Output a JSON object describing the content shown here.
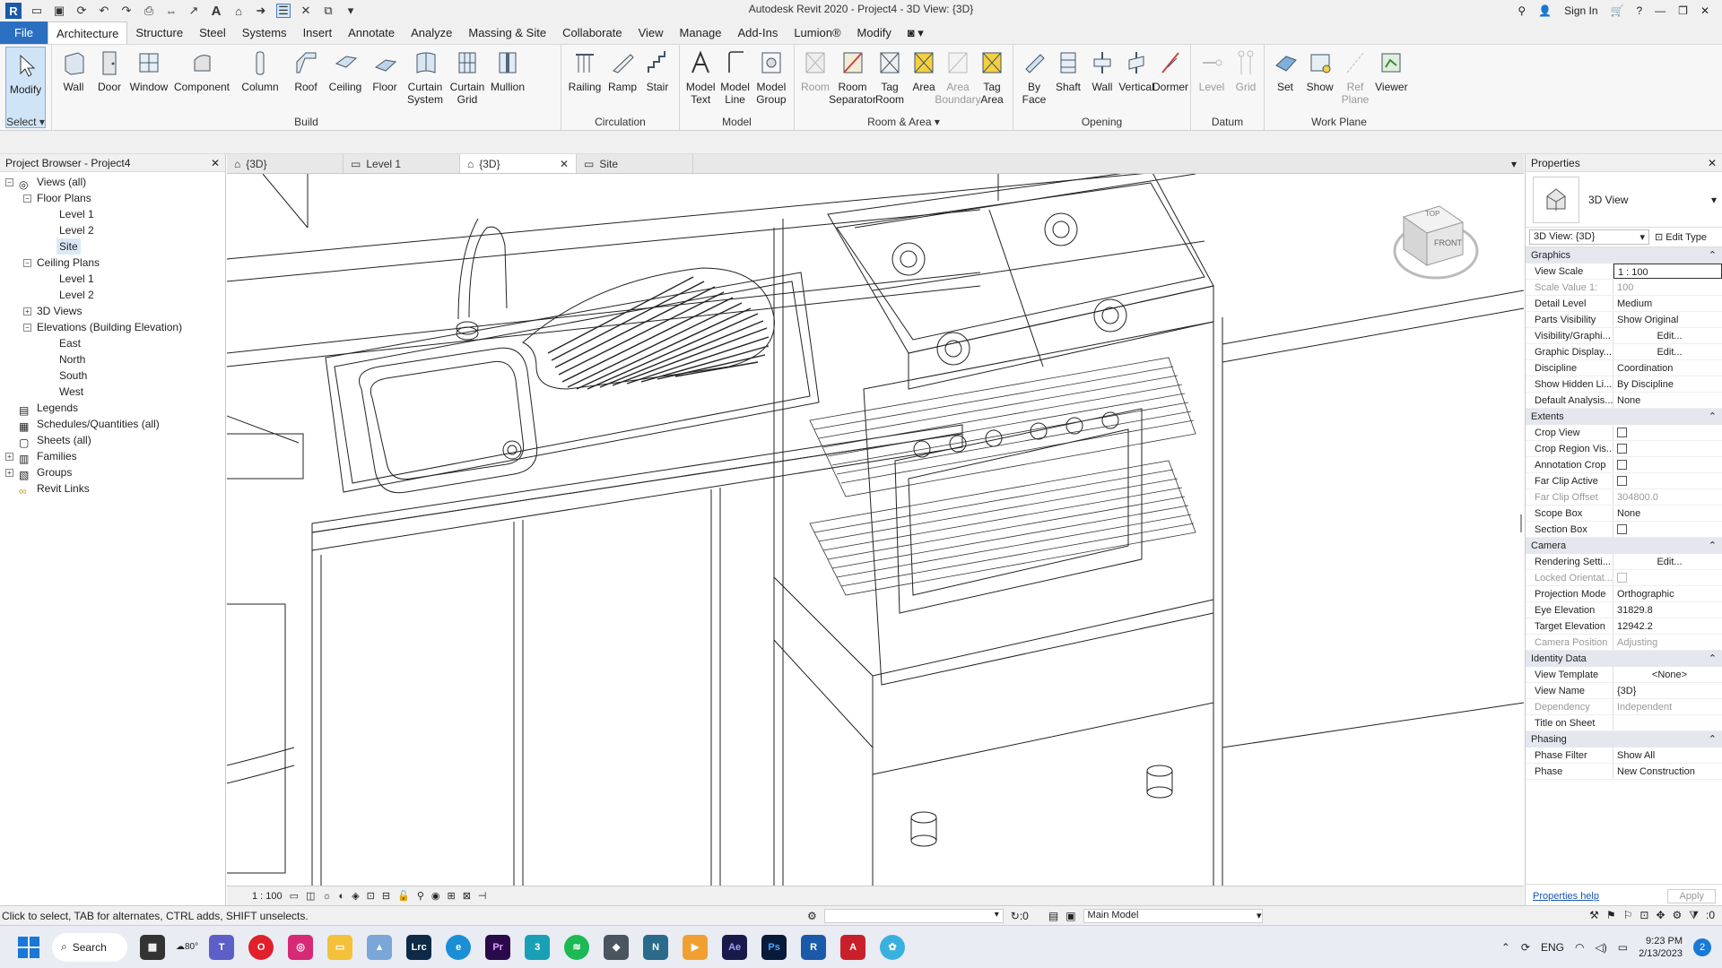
{
  "window": {
    "title": "Autodesk Revit 2020 - Project4 - 3D View: {3D}",
    "sign_in": "Sign In"
  },
  "menu": {
    "file": "File",
    "tabs": [
      "Architecture",
      "Structure",
      "Steel",
      "Systems",
      "Insert",
      "Annotate",
      "Analyze",
      "Massing & Site",
      "Collaborate",
      "View",
      "Manage",
      "Add-Ins",
      "Lumion®",
      "Modify"
    ]
  },
  "ribbon": {
    "select_label": "Select",
    "modify": "Modify",
    "build": {
      "label": "Build",
      "tools": [
        "Wall",
        "Door",
        "Window",
        "Component",
        "Column",
        "Roof",
        "Ceiling",
        "Floor",
        "Curtain System",
        "Curtain Grid",
        "Mullion"
      ]
    },
    "circulation": {
      "label": "Circulation",
      "tools": [
        "Railing",
        "Ramp",
        "Stair"
      ]
    },
    "model": {
      "label": "Model",
      "tools": [
        "Model Text",
        "Model Line",
        "Model Group"
      ]
    },
    "room_area": {
      "label": "Room & Area",
      "tools": [
        "Room",
        "Room Separator",
        "Tag Room",
        "Area",
        "Area Boundary",
        "Tag Area"
      ]
    },
    "opening": {
      "label": "Opening",
      "tools": [
        "By Face",
        "Shaft",
        "Wall",
        "Vertical",
        "Dormer"
      ]
    },
    "datum": {
      "label": "Datum",
      "tools": [
        "Level",
        "Grid"
      ]
    },
    "work_plane": {
      "label": "Work Plane",
      "tools": [
        "Set",
        "Show",
        "Ref Plane",
        "Viewer"
      ]
    }
  },
  "browser": {
    "title": "Project Browser - Project4",
    "items": [
      "Views (all)",
      "Floor Plans",
      "Level 1",
      "Level 2",
      "Site",
      "Ceiling Plans",
      "Level 1",
      "Level 2",
      "3D Views",
      "Elevations (Building Elevation)",
      "East",
      "North",
      "South",
      "West",
      "Legends",
      "Schedules/Quantities (all)",
      "Sheets (all)",
      "Families",
      "Groups",
      "Revit Links"
    ]
  },
  "view_tabs": [
    "{3D}",
    "Level 1",
    "{3D}",
    "Site"
  ],
  "viewcube": {
    "top": "TOP",
    "front": "FRONT"
  },
  "view_scale_status": "1 : 100",
  "properties": {
    "title": "Properties",
    "type_name": "3D View",
    "selector": "3D View: {3D}",
    "edit_type": "Edit Type",
    "sections": [
      {
        "name": "Graphics",
        "rows": [
          {
            "k": "View Scale",
            "v": "1 : 100"
          },
          {
            "k": "Scale Value    1:",
            "v": "100"
          },
          {
            "k": "Detail Level",
            "v": "Medium"
          },
          {
            "k": "Parts Visibility",
            "v": "Show Original"
          },
          {
            "k": "Visibility/Graphi...",
            "v": "Edit..."
          },
          {
            "k": "Graphic Display...",
            "v": "Edit..."
          },
          {
            "k": "Discipline",
            "v": "Coordination"
          },
          {
            "k": "Show Hidden Li...",
            "v": "By Discipline"
          },
          {
            "k": "Default Analysis...",
            "v": "None"
          }
        ]
      },
      {
        "name": "Extents",
        "rows": [
          {
            "k": "Crop View",
            "v": ""
          },
          {
            "k": "Crop Region Vis...",
            "v": ""
          },
          {
            "k": "Annotation Crop",
            "v": ""
          },
          {
            "k": "Far Clip Active",
            "v": ""
          },
          {
            "k": "Far Clip Offset",
            "v": "304800.0"
          },
          {
            "k": "Scope Box",
            "v": "None"
          },
          {
            "k": "Section Box",
            "v": ""
          }
        ]
      },
      {
        "name": "Camera",
        "rows": [
          {
            "k": "Rendering Setti...",
            "v": "Edit..."
          },
          {
            "k": "Locked Orientat...",
            "v": ""
          },
          {
            "k": "Projection Mode",
            "v": "Orthographic"
          },
          {
            "k": "Eye Elevation",
            "v": "31829.8"
          },
          {
            "k": "Target Elevation",
            "v": "12942.2"
          },
          {
            "k": "Camera Position",
            "v": "Adjusting"
          }
        ]
      },
      {
        "name": "Identity Data",
        "rows": [
          {
            "k": "View Template",
            "v": "<None>"
          },
          {
            "k": "View Name",
            "v": "{3D}"
          },
          {
            "k": "Dependency",
            "v": "Independent"
          },
          {
            "k": "Title on Sheet",
            "v": ""
          }
        ]
      },
      {
        "name": "Phasing",
        "rows": [
          {
            "k": "Phase Filter",
            "v": "Show All"
          },
          {
            "k": "Phase",
            "v": "New Construction"
          }
        ]
      }
    ],
    "help": "Properties help",
    "apply": "Apply"
  },
  "status": {
    "hint": "Click to select, TAB for alternates, CTRL adds, SHIFT unselects.",
    "zero": ":0",
    "model": "Main Model",
    "filter_count": ":0"
  },
  "taskbar": {
    "search": "Search",
    "weather": "80°",
    "lang": "ENG",
    "time": "9:23 PM",
    "date": "2/13/2023",
    "notif": "2"
  }
}
